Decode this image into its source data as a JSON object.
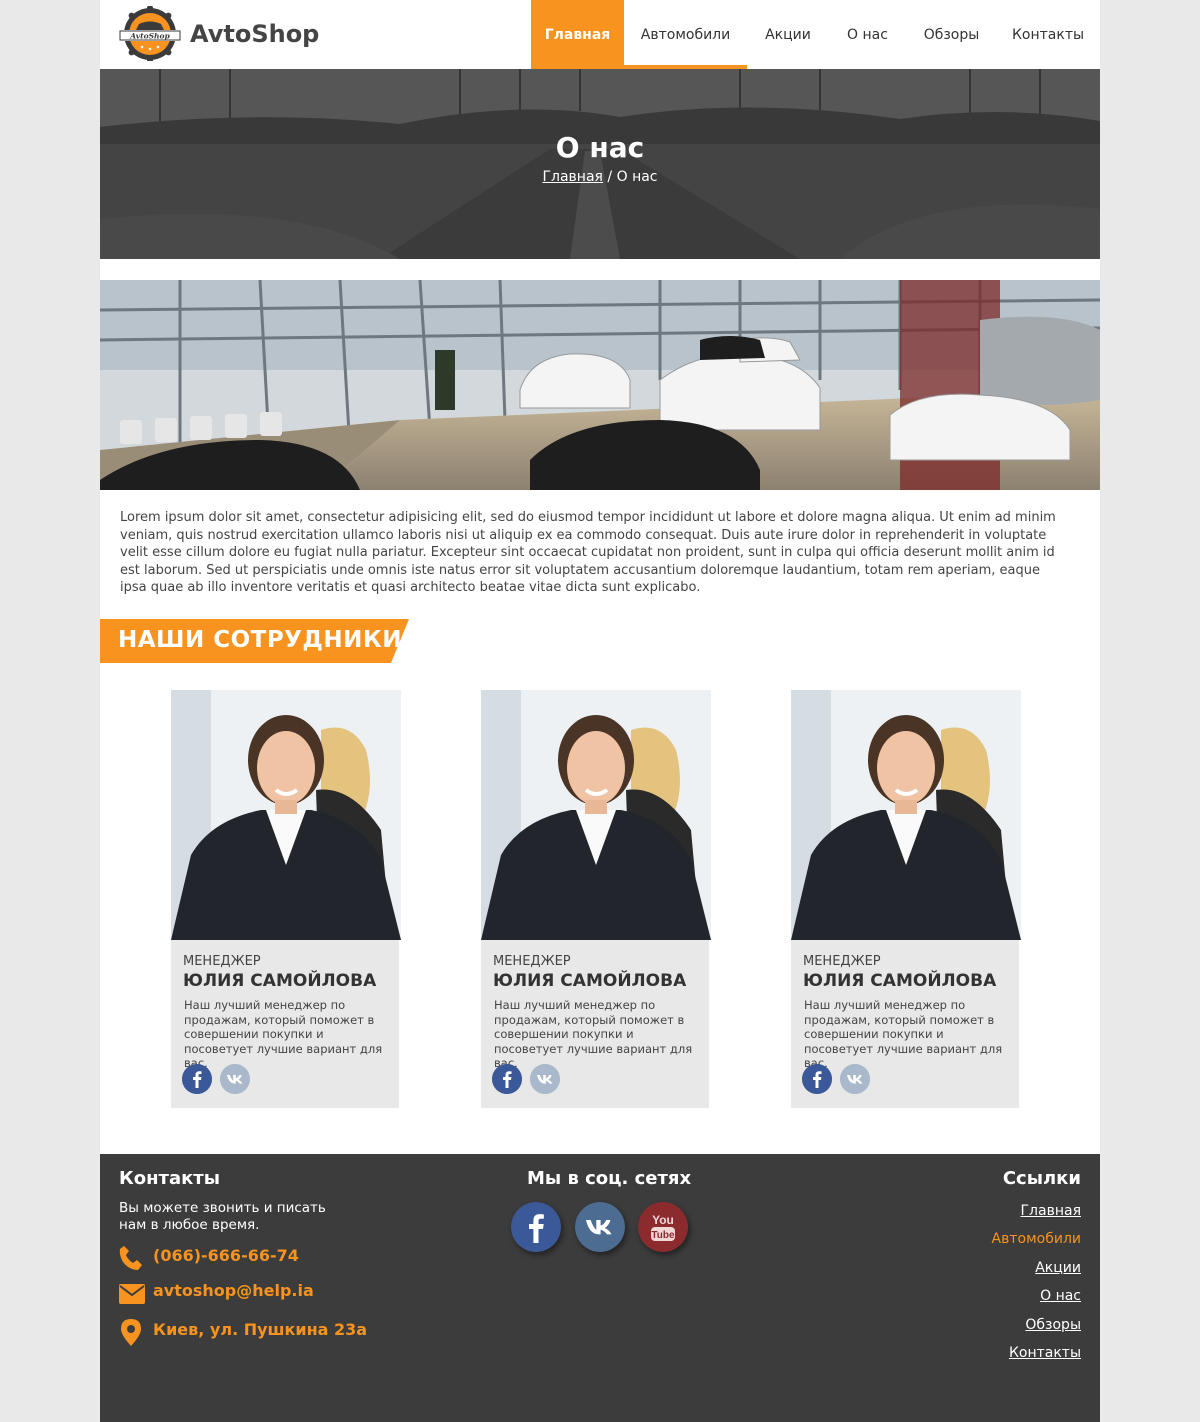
{
  "brand": {
    "name": "AvtoShop",
    "badge_text": "AvtoShop"
  },
  "nav": {
    "items": [
      {
        "label": "Главная"
      },
      {
        "label": "Автомобили"
      },
      {
        "label": "Акции"
      },
      {
        "label": "О нас"
      },
      {
        "label": "Обзоры"
      },
      {
        "label": "Контакты"
      }
    ]
  },
  "hero": {
    "title": "О нас",
    "breadcrumb_home": "Главная",
    "breadcrumb_sep": " / ",
    "breadcrumb_current": "О нас"
  },
  "about": {
    "text": "Lorem ipsum dolor sit amet, consectetur adipisicing elit, sed do eiusmod tempor incididunt ut labore et dolore magna aliqua. Ut enim ad minim veniam, quis nostrud exercitation ullamco laboris nisi ut aliquip ex ea commodo consequat. Duis aute irure dolor in reprehenderit in voluptate velit esse cillum dolore eu fugiat nulla pariatur. Excepteur sint occaecat cupidatat non proident, sunt in culpa qui officia deserunt mollit anim id est laborum. Sed ut perspiciatis unde omnis iste natus error sit voluptatem accusantium doloremque laudantium, totam rem aperiam, eaque ipsa quae ab illo inventore veritatis et quasi architecto beatae vitae dicta sunt explicabo."
  },
  "staff": {
    "heading": "НАШИ СОТРУДНИКИ",
    "members": [
      {
        "role": "МЕНЕДЖЕР",
        "name": "ЮЛИЯ САМОЙЛОВА",
        "desc": "Наш лучший менеджер по продажам, который поможет в совершении покупки и посоветует лучшие вариант для вас."
      },
      {
        "role": "МЕНЕДЖЕР",
        "name": "ЮЛИЯ САМОЙЛОВА",
        "desc": "Наш лучший менеджер по продажам, который поможет в совершении покупки и посоветует лучшие вариант для вас."
      },
      {
        "role": "МЕНЕДЖЕР",
        "name": "ЮЛИЯ САМОЙЛОВА",
        "desc": "Наш лучший менеджер по продажам, который поможет в совершении покупки и посоветует лучшие вариант для вас."
      }
    ]
  },
  "footer": {
    "contacts_title": "Контакты",
    "contacts_text": "Вы можете звонить и писать нам в любое время.",
    "phone": "(066)-666-66-74",
    "email": "avtoshop@help.ia",
    "address": "Киев, ул. Пушкина 23а",
    "social_title": "Мы в соц. сетях",
    "links_title": "Ссылки",
    "links": [
      "Главная",
      "Автомобили",
      "Акции",
      "О нас",
      "Обзоры",
      "Контакты"
    ]
  },
  "colors": {
    "accent": "#f7931e",
    "footer_bg": "#3c3c3c",
    "facebook": "#3b5998",
    "vk": "#4c6c91",
    "youtube": "#8b2b2e"
  }
}
